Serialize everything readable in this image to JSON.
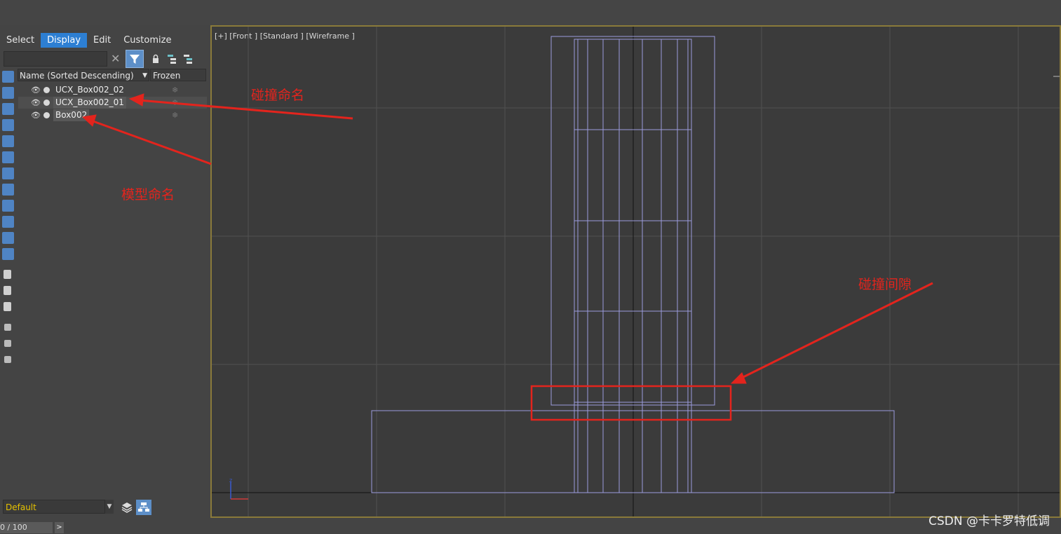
{
  "menu": [
    "Select",
    "Display",
    "Edit",
    "Customize"
  ],
  "active_menu": "Display",
  "columns": {
    "name": "Name (Sorted Descending)",
    "frozen": "Frozen"
  },
  "objects": [
    {
      "name": "UCX_Box002_02"
    },
    {
      "name": "UCX_Box002_01"
    },
    {
      "name": "Box002"
    }
  ],
  "layer": {
    "value": "Default"
  },
  "frame": {
    "value": "0 / 100",
    "next": ">"
  },
  "viewport": {
    "label": "[+] [Front ] [Standard ] [Wireframe ]"
  },
  "annotations": {
    "collision_naming": "碰撞命名",
    "model_naming": "模型命名",
    "collision_gap": "碰撞间隙"
  },
  "watermark": "CSDN @卡卡罗特低调",
  "colors": {
    "accent": "#2d7fd3",
    "annotation": "#e3241d",
    "wire": "#9b9bdc",
    "viewport_border": "#8a7a3a"
  },
  "icons": [
    "close-icon",
    "filter-icon",
    "lock-icon",
    "hierarchy-icon",
    "eye-icon",
    "snowflake-icon",
    "layers-icon"
  ]
}
